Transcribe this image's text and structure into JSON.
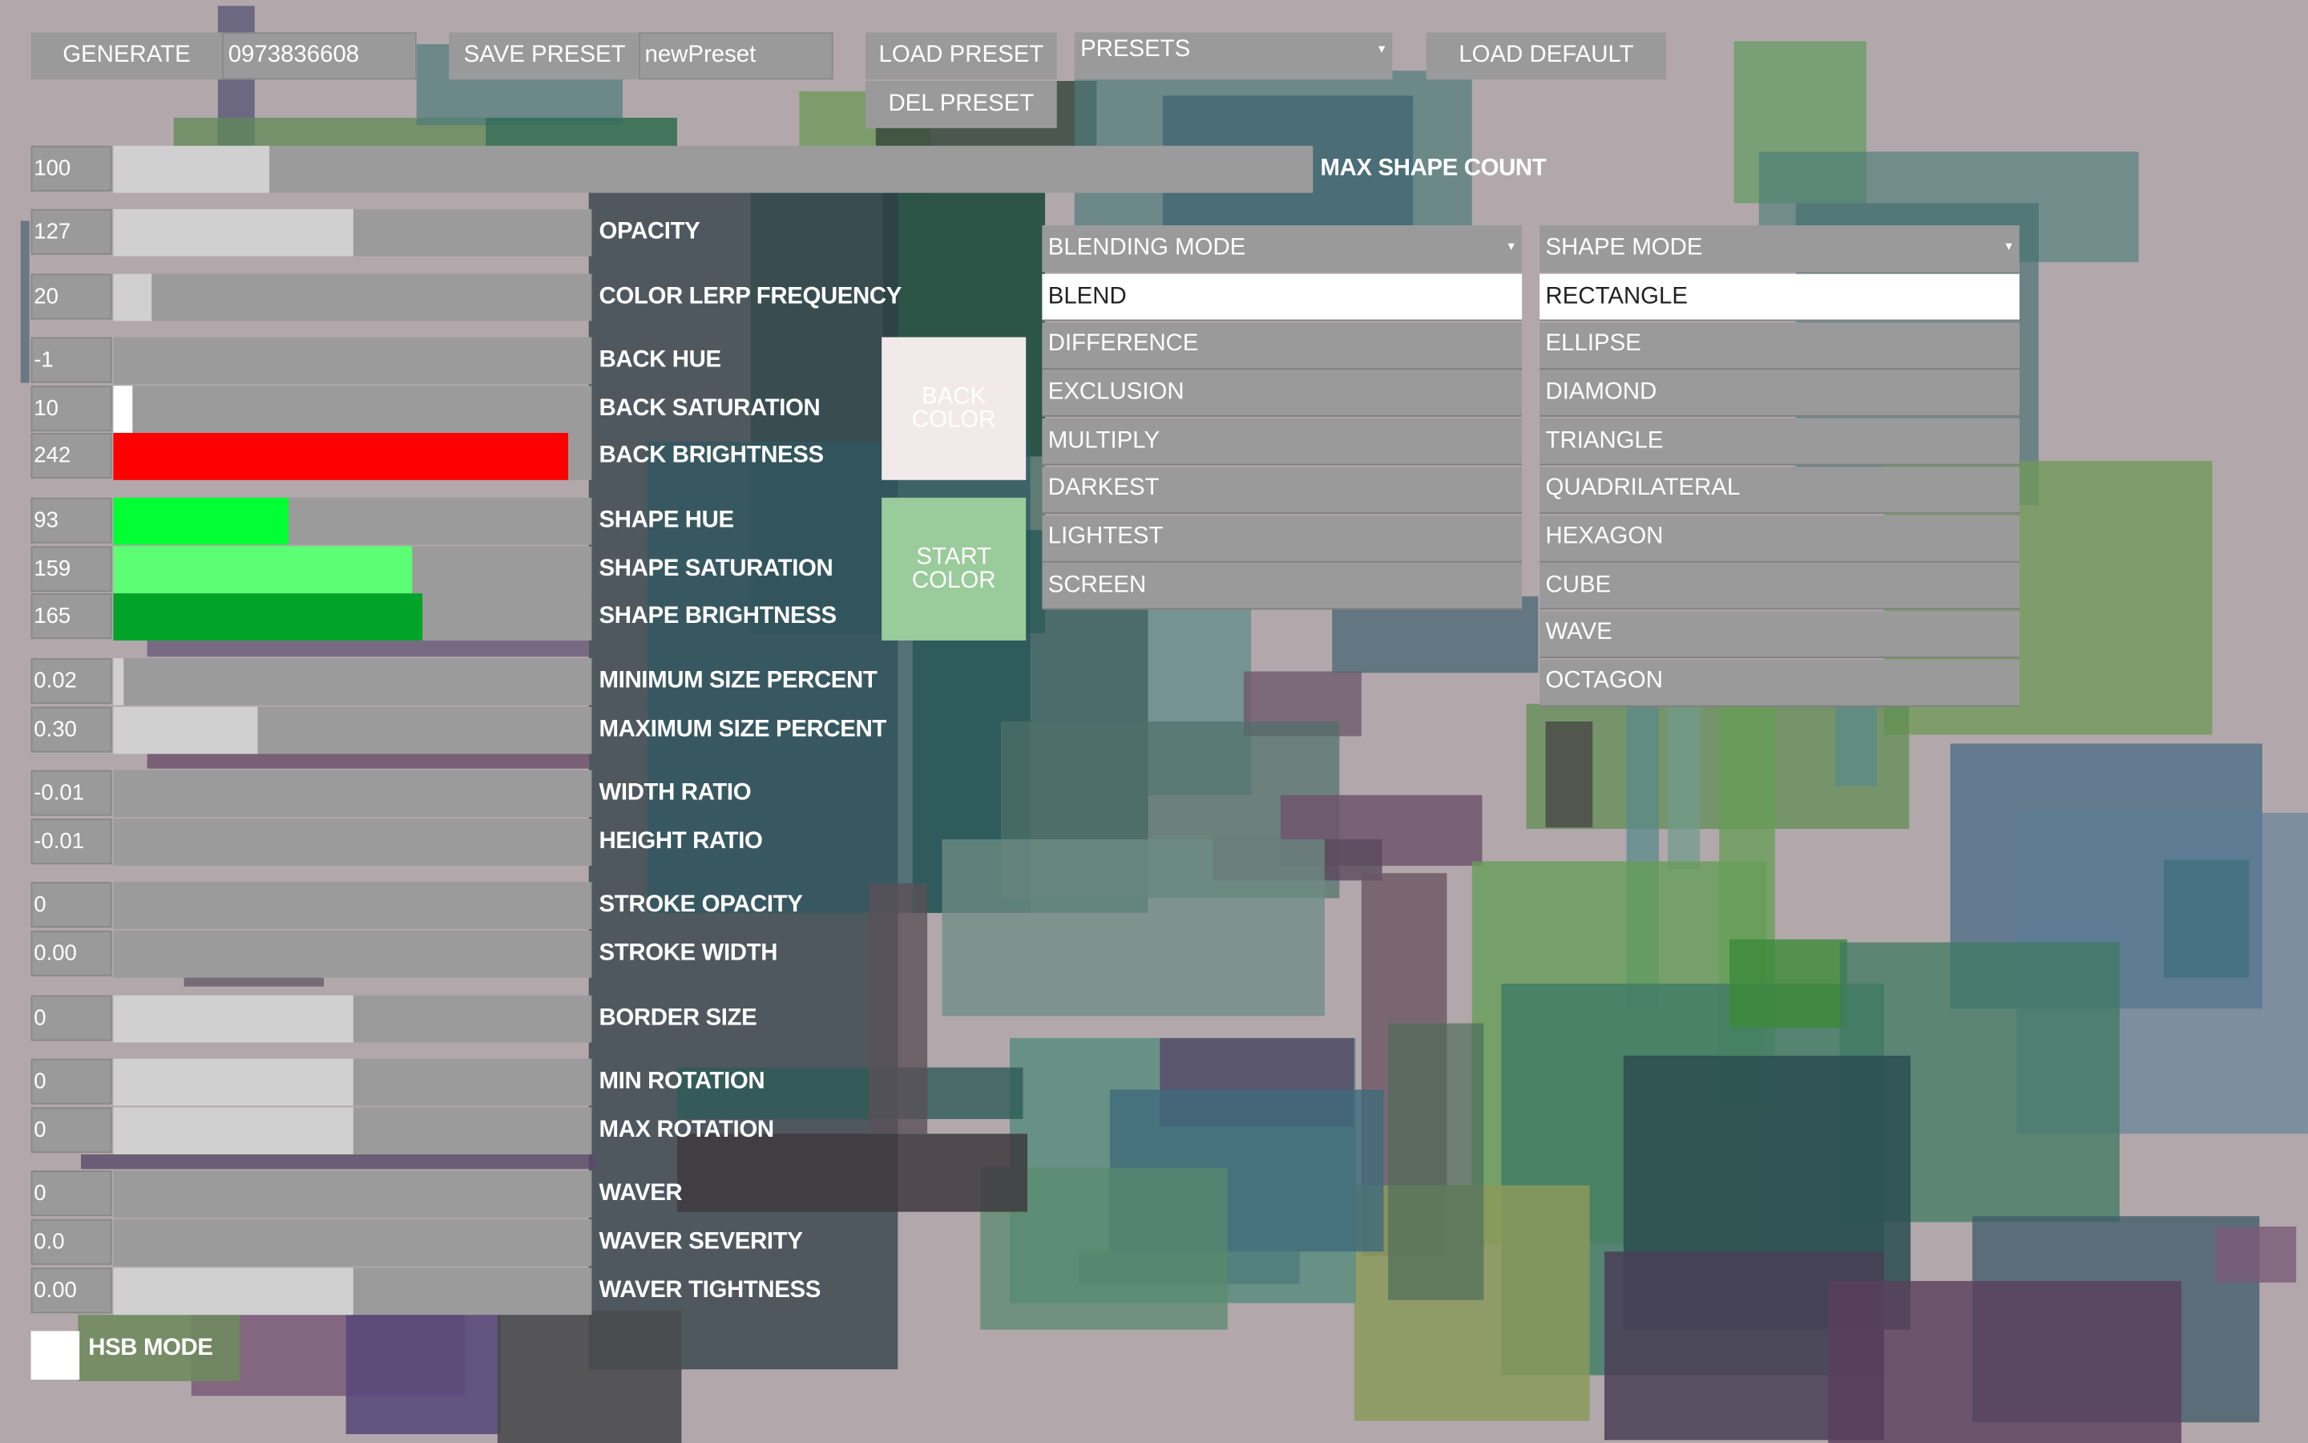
{
  "toolbar": {
    "generate_label": "GENERATE",
    "seed_value": "0973836608",
    "save_preset_label": "SAVE PRESET",
    "preset_name_value": "newPreset",
    "load_preset_label": "LOAD PRESET",
    "del_preset_label": "DEL PRESET",
    "presets_label": "PRESETS",
    "load_default_label": "LOAD DEFAULT"
  },
  "sliders": {
    "max_shape_count": {
      "value": "100",
      "label": "MAX SHAPE COUNT",
      "fill": 0.13
    },
    "opacity": {
      "value": "127",
      "label": "OPACITY",
      "fill": 0.5
    },
    "color_lerp_frequency": {
      "value": "20",
      "label": "COLOR LERP FREQUENCY",
      "fill": 0.08
    },
    "back_hue": {
      "value": "-1",
      "label": "BACK HUE",
      "fill": 0.0
    },
    "back_saturation": {
      "value": "10",
      "label": "BACK SATURATION",
      "fill": 0.04
    },
    "back_brightness": {
      "value": "242",
      "label": "BACK BRIGHTNESS",
      "fill": 0.95
    },
    "shape_hue": {
      "value": "93",
      "label": "SHAPE HUE",
      "fill": 0.365
    },
    "shape_saturation": {
      "value": "159",
      "label": "SHAPE SATURATION",
      "fill": 0.625
    },
    "shape_brightness": {
      "value": "165",
      "label": "SHAPE BRIGHTNESS",
      "fill": 0.645
    },
    "min_size_percent": {
      "value": "0.02",
      "label": "MINIMUM SIZE PERCENT",
      "fill": 0.02
    },
    "max_size_percent": {
      "value": "0.30",
      "label": "MAXIMUM SIZE PERCENT",
      "fill": 0.3
    },
    "width_ratio": {
      "value": "-0.01",
      "label": "WIDTH RATIO",
      "fill": 0.0
    },
    "height_ratio": {
      "value": "-0.01",
      "label": "HEIGHT RATIO",
      "fill": 0.0
    },
    "stroke_opacity": {
      "value": "0",
      "label": "STROKE OPACITY",
      "fill": 0.0
    },
    "stroke_width": {
      "value": "0.00",
      "label": "STROKE WIDTH",
      "fill": 0.0
    },
    "border_size": {
      "value": "0",
      "label": "BORDER SIZE",
      "fill": 0.5
    },
    "min_rotation": {
      "value": "0",
      "label": "MIN ROTATION",
      "fill": 0.5
    },
    "max_rotation": {
      "value": "0",
      "label": "MAX ROTATION",
      "fill": 0.5
    },
    "waver": {
      "value": "0",
      "label": "WAVER",
      "fill": 0.0
    },
    "waver_severity": {
      "value": "0.0",
      "label": "WAVER SEVERITY",
      "fill": 0.0
    },
    "waver_tightness": {
      "value": "0.00",
      "label": "WAVER TIGHTNESS",
      "fill": 0.5
    }
  },
  "swatches": {
    "back_color_label_1": "BACK",
    "back_color_label_2": "COLOR",
    "back_color": "#f2eaea",
    "start_color_label_1": "START",
    "start_color_label_2": "COLOR",
    "start_color": "#9acb9a"
  },
  "blending_mode": {
    "label": "BLENDING MODE",
    "selected": "BLEND",
    "options": [
      "BLEND",
      "DIFFERENCE",
      "EXCLUSION",
      "MULTIPLY",
      "DARKEST",
      "LIGHTEST",
      "SCREEN"
    ]
  },
  "shape_mode": {
    "label": "SHAPE MODE",
    "selected": "RECTANGLE",
    "options": [
      "RECTANGLE",
      "ELLIPSE",
      "DIAMOND",
      "TRIANGLE",
      "QUADRILATERAL",
      "HEXAGON",
      "CUBE",
      "WAVE",
      "OCTAGON"
    ]
  },
  "hsb_mode": {
    "label": "HSB MODE",
    "checked": false
  },
  "colors": {
    "background": "#b2a8ab",
    "control": "#9a9a9a",
    "back_brightness_fill": "#ff0000",
    "shape_hue_fill": "#00ff33",
    "shape_saturation_fill": "#5cff74",
    "shape_brightness_fill": "#00a428"
  }
}
